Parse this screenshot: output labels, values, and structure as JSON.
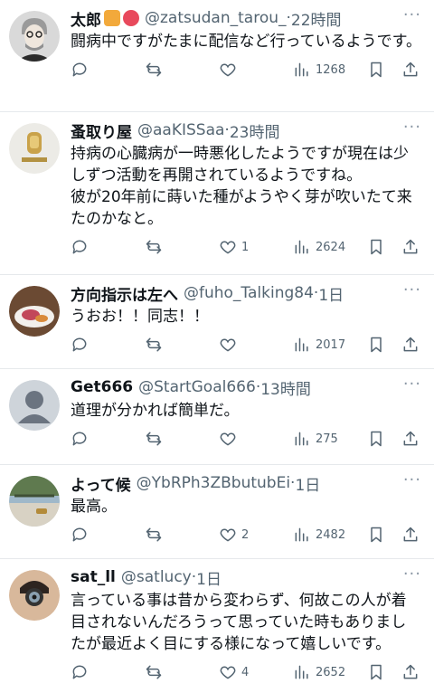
{
  "posts": [
    {
      "name": "太郎",
      "handle": "@zatsudan_tarou_",
      "separator": "·",
      "time": "22時間",
      "text": "闘病中ですがたまに配信など行っているようです。",
      "likes": "",
      "views": "1268",
      "avatar": "gray-haired-man-avatar",
      "badges": [
        "tiger-emoji",
        "hibiscus-emoji"
      ]
    },
    {
      "name": "蚤取り屋",
      "handle": "@aaKISSaa",
      "separator": "·",
      "time": "23時間",
      "text": "持病の心臓病が一時悪化したようですが現在は少しずつ活動を再開されているようですね。\n彼が20年前に蒔いた種がようやく芽が吹いたて来たのかなと。",
      "likes": "1",
      "views": "2624",
      "avatar": "amulet-logo-avatar"
    },
    {
      "name": "方向指示は左へ",
      "handle": "@fuho_Talking84",
      "separator": "·",
      "time": "1日",
      "text": "うおお！！同志！！",
      "likes": "",
      "views": "2017",
      "avatar": "food-photo-avatar"
    },
    {
      "name": "Get666",
      "handle": "@StartGoal666",
      "separator": "·",
      "time": "13時間",
      "text": "道理が分かれば簡単だ。",
      "likes": "",
      "views": "275",
      "avatar": "default-user-avatar"
    },
    {
      "name": "よって候",
      "handle": "@YbRPh3ZBbutubEi",
      "separator": "·",
      "time": "1日",
      "text": "最高。",
      "likes": "2",
      "views": "2482",
      "avatar": "garden-photo-avatar"
    },
    {
      "name": "sat_ll",
      "handle": "@satlucy",
      "separator": "·",
      "time": "1日",
      "text": "言っている事は昔から変わらず、何故この人が着目されないんだろうって思っていた時もありましたが最近よく目にする様になって嬉しいです。",
      "likes": "4",
      "views": "2652",
      "avatar": "camera-face-avatar"
    }
  ],
  "more_label": "···",
  "colors": {
    "text": "#0f1419",
    "secondary": "#536471",
    "divider": "#e6e9ec"
  }
}
